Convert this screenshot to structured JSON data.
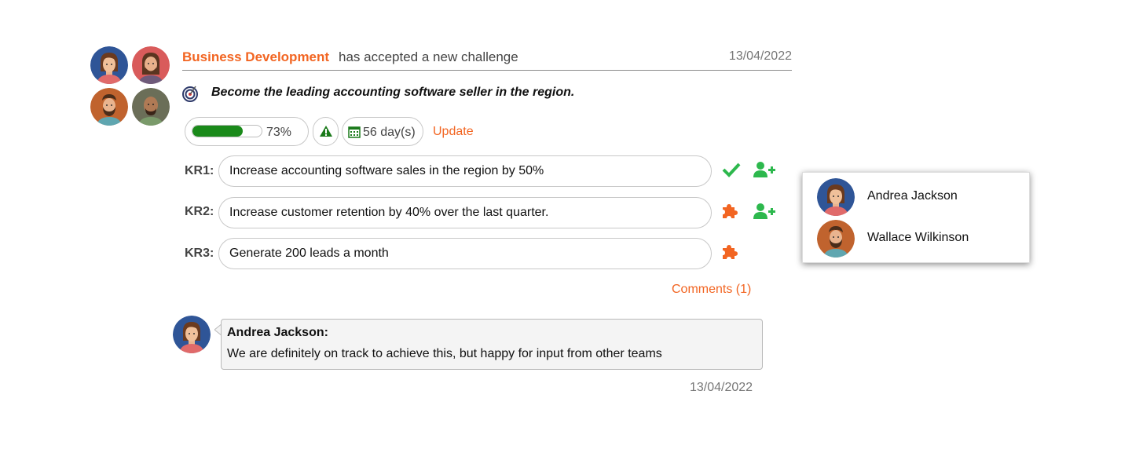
{
  "header": {
    "team": "Business Development",
    "action": "has accepted a new challenge",
    "date": "13/04/2022"
  },
  "objective": "Become the leading accounting software seller in the region.",
  "status": {
    "progress_percent": 73,
    "progress_label": "73%",
    "days_label": "56 day(s)",
    "update_label": "Update",
    "colors": {
      "progress": "#1a8a1a",
      "accent": "#f26522",
      "success": "#2db84d"
    }
  },
  "key_results": [
    {
      "label": "KR1:",
      "text": "Increase accounting software sales in the region by 50%",
      "status_icon": "check-icon",
      "assign": true
    },
    {
      "label": "KR2:",
      "text": "Increase customer retention by 40% over the last quarter.",
      "status_icon": "puzzle-icon",
      "assign": true
    },
    {
      "label": "KR3:",
      "text": "Generate 200 leads a month",
      "status_icon": "puzzle-icon",
      "assign": false
    }
  ],
  "comments_label": "Comments (1)",
  "comment": {
    "author": "Andrea Jackson:",
    "text": "We are definitely on track to achieve this, but happy for input from other teams",
    "date": "13/04/2022"
  },
  "assign_menu": {
    "items": [
      {
        "name": "Andrea Jackson"
      },
      {
        "name": "Wallace Wilkinson"
      }
    ]
  }
}
